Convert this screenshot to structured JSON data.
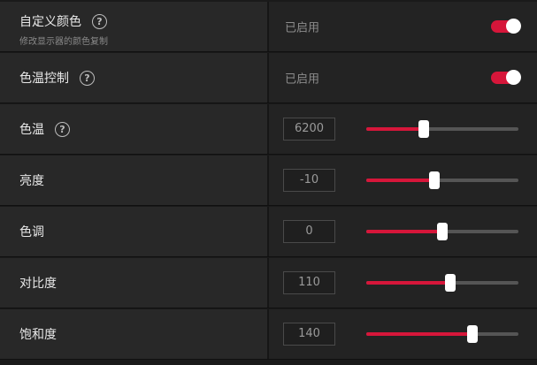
{
  "rows": [
    {
      "label": "自定义颜色",
      "sublabel": "修改显示器的颜色复制",
      "help": "?",
      "status": "已启用",
      "toggle_on": true
    },
    {
      "label": "色温控制",
      "help": "?",
      "status": "已启用",
      "toggle_on": true
    },
    {
      "label": "色温",
      "help": "?",
      "value": "6200",
      "slider_fraction": 0.38
    },
    {
      "label": "亮度",
      "value": "-10",
      "slider_fraction": 0.45
    },
    {
      "label": "色调",
      "value": "0",
      "slider_fraction": 0.5
    },
    {
      "label": "对比度",
      "value": "110",
      "slider_fraction": 0.55
    },
    {
      "label": "饱和度",
      "value": "140",
      "slider_fraction": 0.7
    }
  ],
  "colors": {
    "accent": "#d6163a",
    "track": "#555555",
    "thumb": "#ffffff"
  }
}
